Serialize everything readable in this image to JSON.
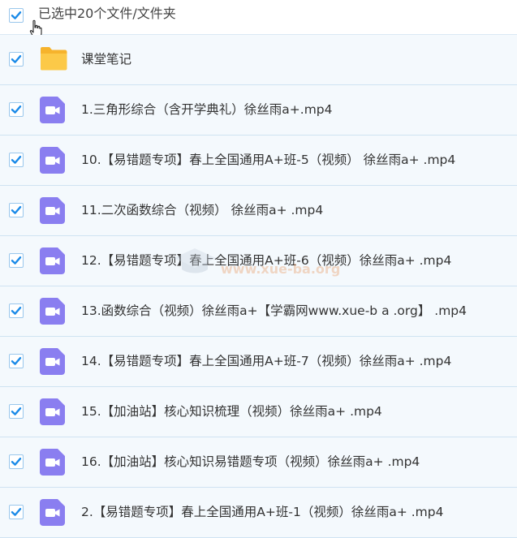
{
  "header": {
    "selection_text": "已选中20个文件/文件夹"
  },
  "colors": {
    "checkbox_accent": "#1a8ae8",
    "video_icon": "#8a7ef0",
    "folder_icon": "#fbc63e",
    "row_border": "#cfe3f2"
  },
  "rows": [
    {
      "name": "课堂笔记",
      "icon": "folder-icon"
    },
    {
      "name": "1.三角形综合（含开学典礼）徐丝雨a+.mp4",
      "icon": "video-icon"
    },
    {
      "name": "10.【易错题专项】春上全国通用A+班-5（视频） 徐丝雨a+ .mp4",
      "icon": "video-icon"
    },
    {
      "name": "11.二次函数综合（视频） 徐丝雨a+ .mp4",
      "icon": "video-icon"
    },
    {
      "name": "12.【易错题专项】春上全国通用A+班-6（视频）徐丝雨a+ .mp4",
      "icon": "video-icon"
    },
    {
      "name": "13.函数综合（视频）徐丝雨a+【学霸网www.xue-b a .org】 .mp4",
      "icon": "video-icon"
    },
    {
      "name": "14.【易错题专项】春上全国通用A+班-7（视频）徐丝雨a+ .mp4",
      "icon": "video-icon"
    },
    {
      "name": "15.【加油站】核心知识梳理（视频）徐丝雨a+ .mp4",
      "icon": "video-icon"
    },
    {
      "name": "16.【加油站】核心知识易错题专项（视频）徐丝雨a+ .mp4",
      "icon": "video-icon"
    },
    {
      "name": "2.【易错题专项】春上全国通用A+班-1（视频）徐丝雨a+ .mp4",
      "icon": "video-icon"
    }
  ],
  "watermark": {
    "text": "www.xue-ba.org"
  }
}
